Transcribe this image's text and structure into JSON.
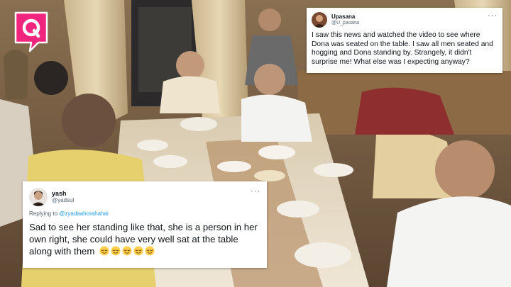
{
  "brand": {
    "logo_icon": "the-quint-q-logo-icon",
    "accent": "#f0257e"
  },
  "photo": {
    "description_icon": "dinner-table-scene"
  },
  "tweet_top": {
    "display_name": "Upasana",
    "handle": "@U_pasana",
    "more_label": "···",
    "text": "I saw this news and watched the video to see where Dona was seated on the table. I saw all men seated and hogging and Dona standing by. Strangely, it didn't surprise me! What else was I expecting anyway?"
  },
  "tweet_bottom": {
    "display_name": "yash",
    "handle": "@yadsul",
    "more_label": "···",
    "replying_prefix": "Replying to",
    "replying_to": "@zyadaahorahahai",
    "text": "Sad to see her standing like that, she is a person in her own right, she could have very well sat at the table along with them",
    "emoji_count": 5,
    "emoji_icon": "relieved-face-emoji"
  }
}
